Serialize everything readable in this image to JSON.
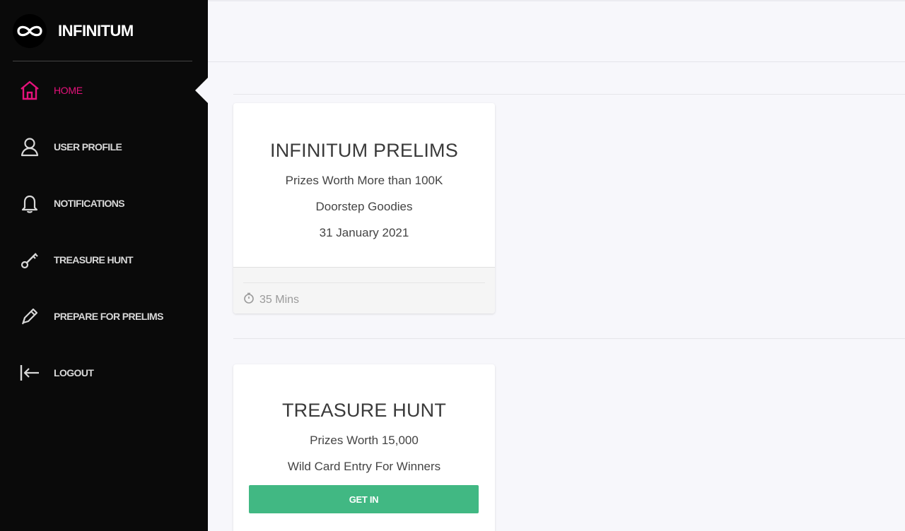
{
  "brand": {
    "name": "INFINITUM",
    "logo_icon": "infinity-icon"
  },
  "sidebar": {
    "items": [
      {
        "label": "HOME",
        "icon": "home-icon",
        "active": true
      },
      {
        "label": "USER PROFILE",
        "icon": "user-icon",
        "active": false
      },
      {
        "label": "NOTIFICATIONS",
        "icon": "bell-icon",
        "active": false
      },
      {
        "label": "TREASURE HUNT",
        "icon": "key-icon",
        "active": false
      },
      {
        "label": "PREPARE FOR PRELIMS",
        "icon": "pencil-icon",
        "active": false
      },
      {
        "label": "LOGOUT",
        "icon": "logout-icon",
        "active": false
      }
    ]
  },
  "cards": {
    "prelims": {
      "title": "INFINITUM PRELIMS",
      "line1": "Prizes Worth More than 100K",
      "line2": "Doorstep Goodies",
      "line3": "31 January 2021",
      "duration": "35 Mins"
    },
    "treasure": {
      "title": "TREASURE HUNT",
      "line1": "Prizes Worth 15,000",
      "line2": "Wild Card Entry For Winners",
      "button_label": "GET IN"
    }
  },
  "colors": {
    "sidebar_bg": "#0a0a0a",
    "accent_active": "#e5127b",
    "button_green": "#41b883",
    "main_bg": "#f7f7fb"
  }
}
